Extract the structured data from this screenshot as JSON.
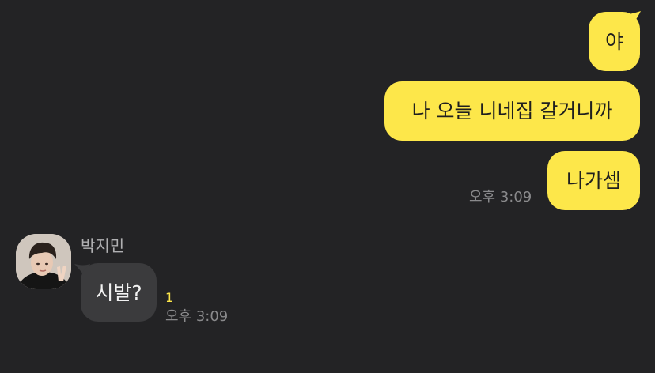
{
  "messages_out": [
    {
      "text": "야"
    },
    {
      "text": "나 오늘 니네집 갈거니까"
    },
    {
      "text": "나가셈"
    }
  ],
  "time_out": "오후 3:09",
  "incoming": {
    "sender": "박지민",
    "text": "시발?",
    "unread": "1",
    "time": "오후 3:09"
  },
  "colors": {
    "background": "#232325",
    "outgoing_bubble": "#fde74a",
    "incoming_bubble": "#3b3b3d",
    "unread": "#fde74a"
  },
  "icons": {
    "avatar": "profile-photo"
  }
}
